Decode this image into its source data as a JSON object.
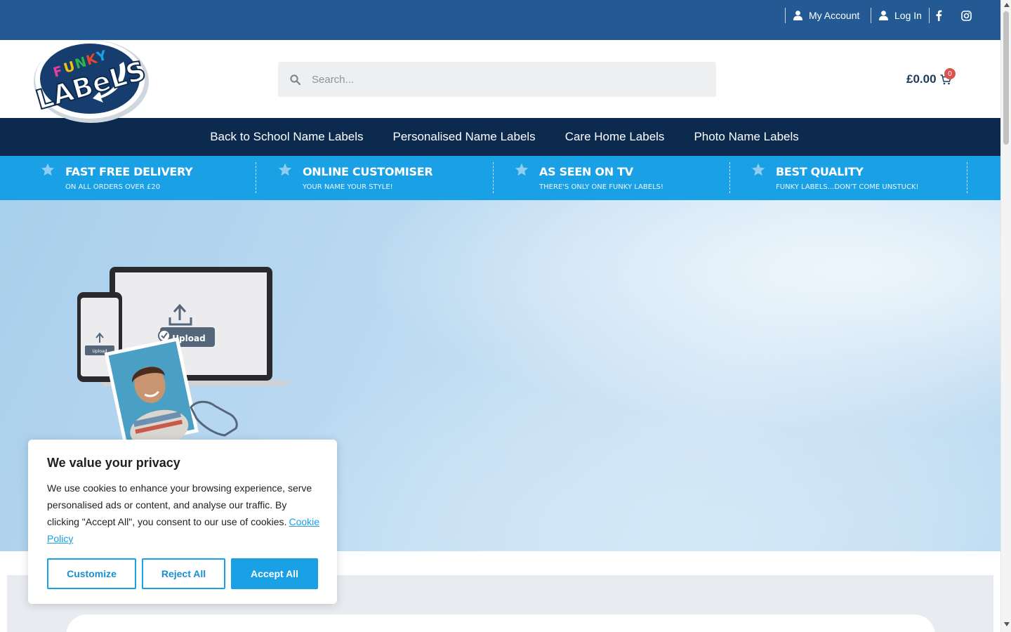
{
  "topbar": {
    "my_account": "My Account",
    "log_in": "Log In",
    "social_icons": [
      "facebook-icon",
      "instagram-icon"
    ]
  },
  "logo": {
    "line1": "FUNKY",
    "line2": "LABeLS"
  },
  "search": {
    "placeholder": "Search..."
  },
  "cart": {
    "total": "£0.00",
    "count": "0"
  },
  "nav": {
    "items": [
      "Back to School Name Labels",
      "Personalised Name Labels",
      "Care Home Labels",
      "Photo Name Labels"
    ]
  },
  "features": [
    {
      "title": "FAST FREE DELIVERY",
      "subtitle": "ON ALL ORDERS OVER £20"
    },
    {
      "title": "ONLINE CUSTOMISER",
      "subtitle": "YOUR NAME YOUR STYLE!"
    },
    {
      "title": "AS SEEN ON TV",
      "subtitle": "THERE'S ONLY ONE FUNKY LABELS!"
    },
    {
      "title": "BEST QUALITY",
      "subtitle": "FUNKY LABELS...DON'T COME UNSTUCK!"
    }
  ],
  "hero": {
    "upload_label": "Upload",
    "upload_small": "Upload"
  },
  "cookie": {
    "title": "We value your privacy",
    "text": "We use cookies to enhance your browsing experience, serve personalised ads or content, and analyse our traffic. By clicking \"Accept All\", you consent to our use of cookies.",
    "policy_link": "Cookie Policy",
    "customize": "Customize",
    "reject": "Reject All",
    "accept": "Accept All"
  },
  "colors": {
    "topbar": "#245a94",
    "nav": "#0b2a4e",
    "features": "#1aa0e4",
    "accent": "#1aa0e4",
    "badge": "#d9534f"
  }
}
